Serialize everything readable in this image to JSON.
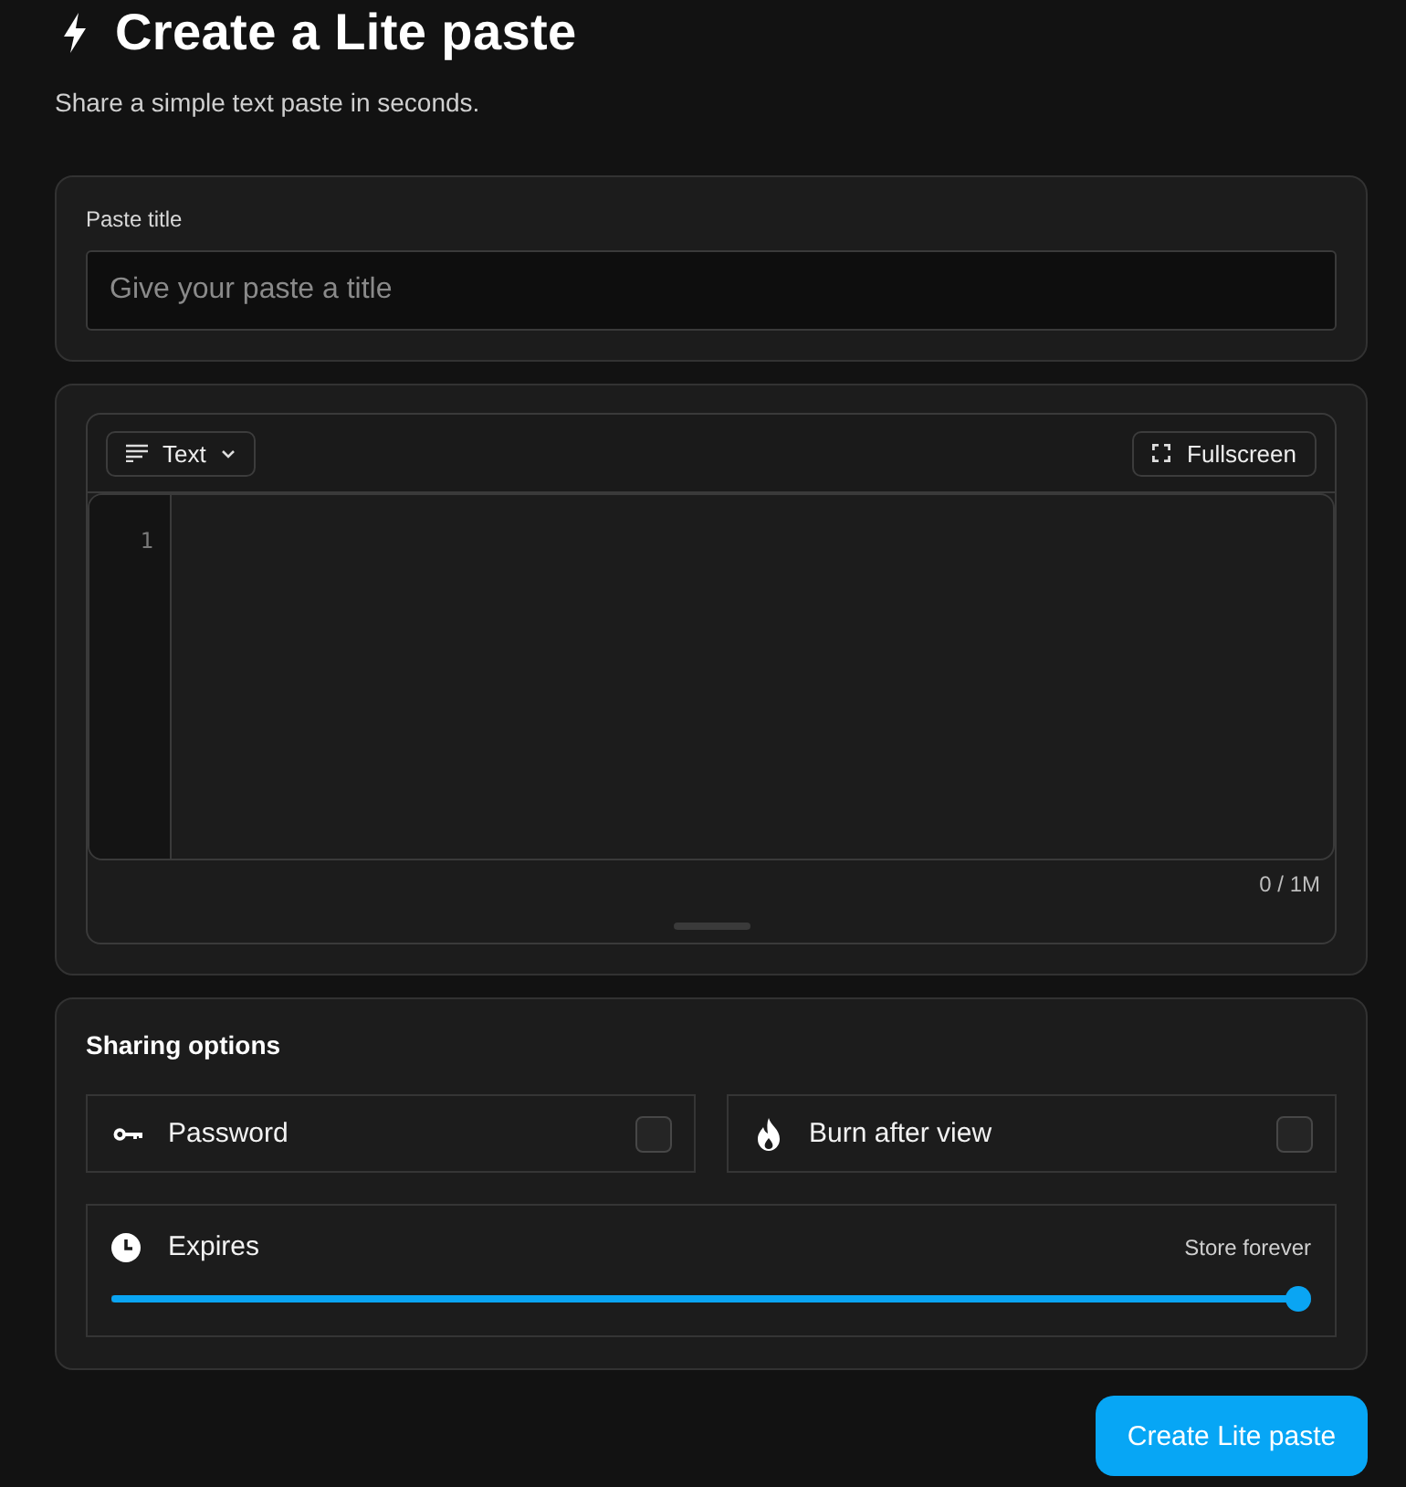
{
  "header": {
    "title": "Create a Lite paste",
    "subtitle": "Share a simple text paste in seconds."
  },
  "title_field": {
    "label": "Paste title",
    "placeholder": "Give your paste a title"
  },
  "editor": {
    "language": "Text",
    "fullscreen": "Fullscreen",
    "line_numbers": [
      "1"
    ],
    "counter": "0 / 1M"
  },
  "sharing": {
    "heading": "Sharing options",
    "options": [
      {
        "label": "Password",
        "checked": false
      },
      {
        "label": "Burn after view",
        "checked": false
      }
    ],
    "expires": {
      "label": "Expires",
      "reading": "Store forever",
      "level": 1
    }
  },
  "submit": "Create Lite paste"
}
